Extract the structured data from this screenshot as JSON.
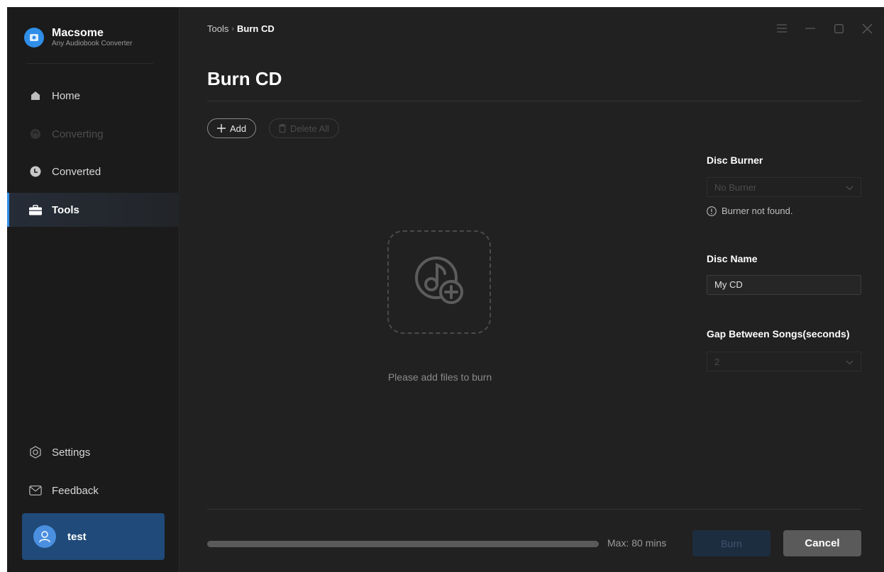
{
  "app": {
    "name": "Macsome",
    "subtitle": "Any Audiobook Converter"
  },
  "sidebar": {
    "items": [
      {
        "label": "Home",
        "icon": "home-icon",
        "state": "normal"
      },
      {
        "label": "Converting",
        "icon": "converting-icon",
        "state": "disabled"
      },
      {
        "label": "Converted",
        "icon": "clock-icon",
        "state": "normal"
      },
      {
        "label": "Tools",
        "icon": "toolbox-icon",
        "state": "active"
      },
      {
        "label": "Settings",
        "icon": "gear-icon",
        "state": "normal"
      },
      {
        "label": "Feedback",
        "icon": "envelope-icon",
        "state": "normal"
      }
    ],
    "user": {
      "name": "test",
      "icon": "user-icon"
    }
  },
  "header": {
    "breadcrumb": {
      "parent": "Tools",
      "separator": "›",
      "current": "Burn CD"
    }
  },
  "main": {
    "title": "Burn CD",
    "add_label": "Add",
    "delete_all_label": "Delete All",
    "empty_message": "Please add files to burn"
  },
  "settings": {
    "disc_burner": {
      "label": "Disc Burner",
      "value": "No Burner",
      "hint": "Burner not found."
    },
    "disc_name": {
      "label": "Disc Name",
      "value": "My CD"
    },
    "gap": {
      "label": "Gap Between Songs(seconds)",
      "value": "2"
    }
  },
  "footer": {
    "max_label": "Max: 80 mins",
    "progress": 0,
    "burn_label": "Burn",
    "cancel_label": "Cancel"
  },
  "colors": {
    "accent": "#2f8ee8",
    "background": "#212121",
    "sidebar": "#1b1b1b",
    "user_card": "#1f4a79"
  }
}
